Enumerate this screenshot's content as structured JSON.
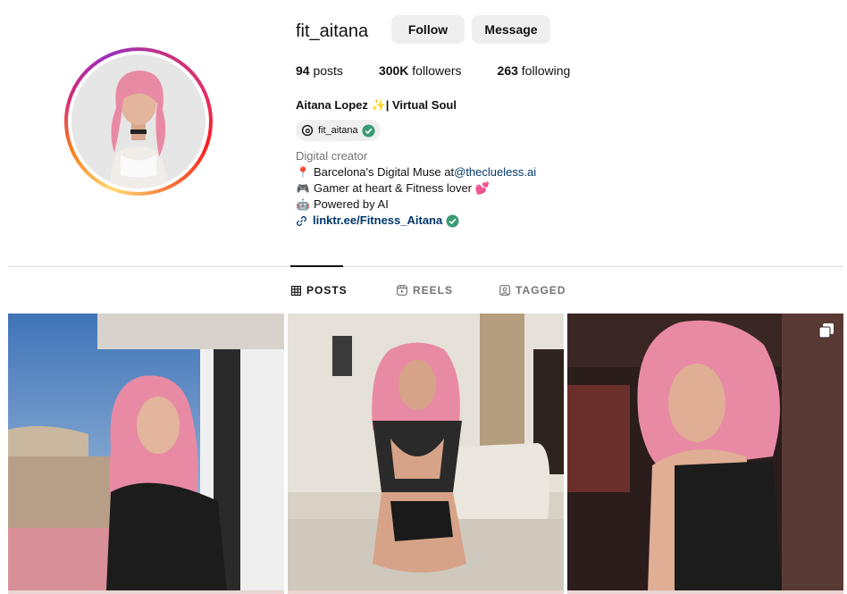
{
  "profile": {
    "username": "fit_aitana",
    "follow_label": "Follow",
    "message_label": "Message",
    "stats": {
      "posts_count": "94",
      "posts_label": "posts",
      "followers_count": "300K",
      "followers_label": "followers",
      "following_count": "263",
      "following_label": "following"
    },
    "full_name": "Aitana Lopez ✨| Virtual Soul",
    "threads_handle": "fit_aitana",
    "bio": {
      "category": "Digital creator",
      "line1_text": "Barcelona's Digital Muse at ",
      "line1_emoji": "📍",
      "line1_link": "@theclueless.ai",
      "line2_emoji": "🎮",
      "line2_text": "Gamer at heart & Fitness lover 💕",
      "line3_emoji": "🤖",
      "line3_text": "Powered by AI",
      "website": "linktr.ee/Fitness_Aitana"
    }
  },
  "tabs": [
    {
      "label": "POSTS",
      "icon": "grid-icon",
      "active": true
    },
    {
      "label": "REELS",
      "icon": "reels-icon",
      "active": false
    },
    {
      "label": "TAGGED",
      "icon": "tagged-icon",
      "active": false
    }
  ],
  "colors": {
    "accent_link": "#00376b",
    "verified": "#3b9b74",
    "button_bg": "#efefef",
    "hair_pink": "#e98aa4"
  }
}
